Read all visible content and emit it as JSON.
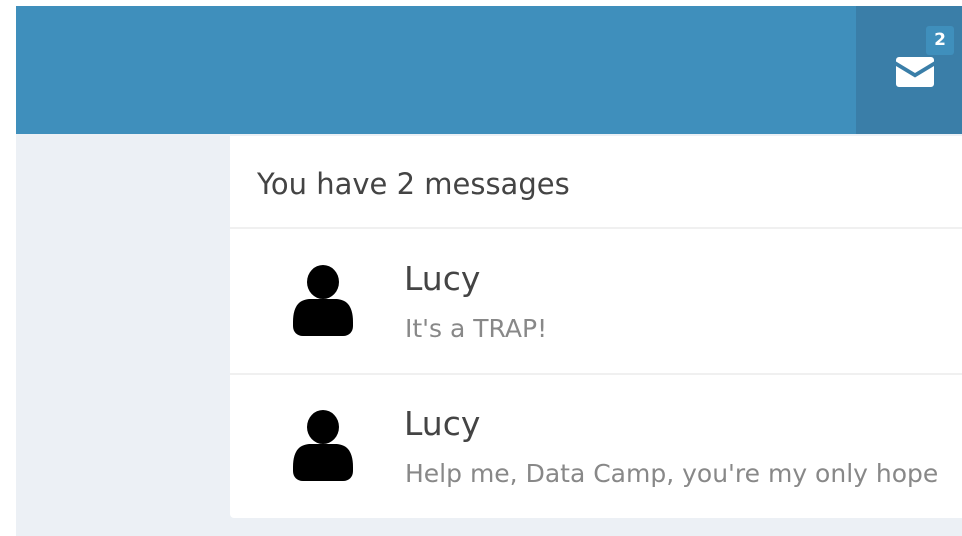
{
  "navbar": {
    "messages": {
      "icon": "envelope-icon",
      "count": "2"
    }
  },
  "messages_menu": {
    "header": "You have 2 messages",
    "items": [
      {
        "avatar_icon": "user-icon",
        "name": "Lucy",
        "text": "It's a TRAP!"
      },
      {
        "avatar_icon": "user-icon",
        "name": "Lucy",
        "text": "Help me, Data Camp, you're my only hope"
      }
    ]
  },
  "colors": {
    "header_bg": "#3f8fbc",
    "header_active_bg": "#3a7ea8",
    "page_bg": "#ecf0f5"
  }
}
